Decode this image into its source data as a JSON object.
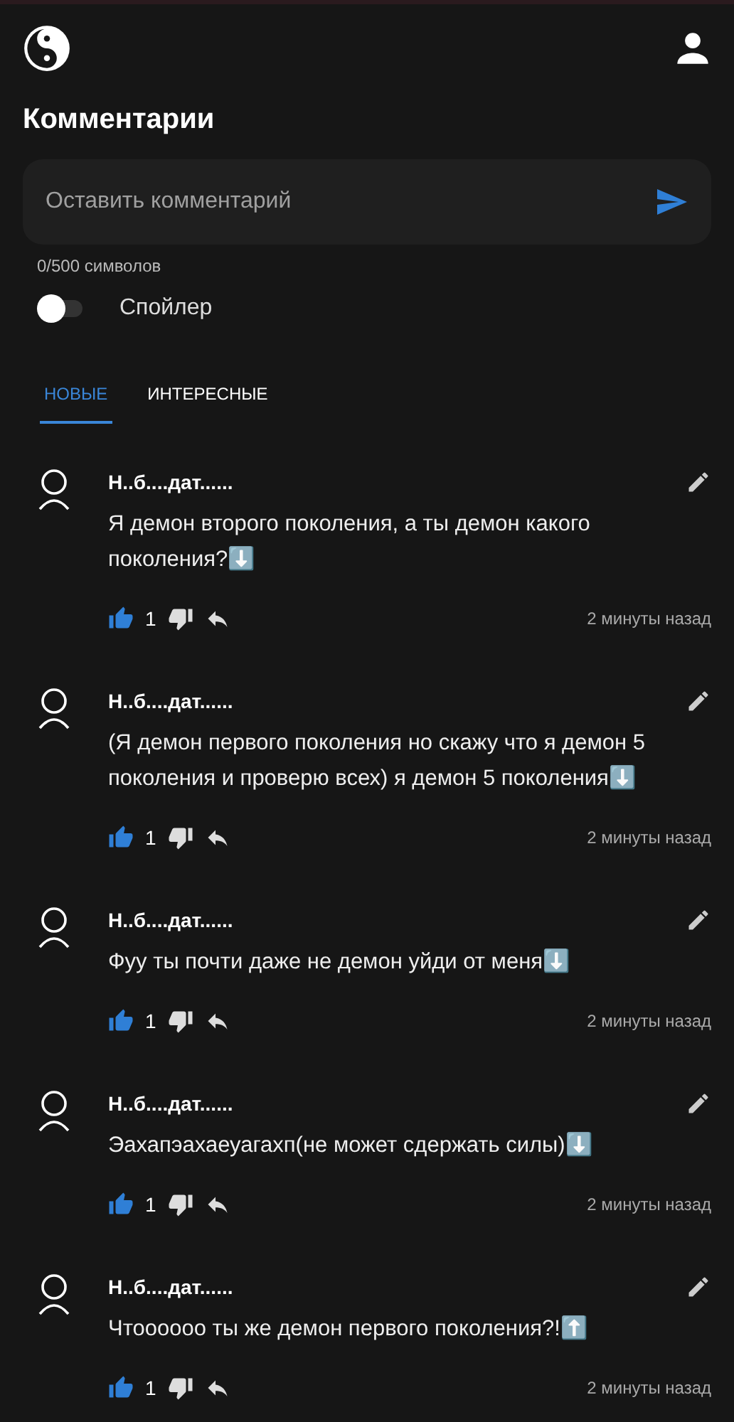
{
  "header": {
    "title": "Комментарии"
  },
  "composer": {
    "placeholder": "Оставить комментарий",
    "counter": "0/500 символов"
  },
  "spoiler": {
    "label": "Спойлер",
    "on": false
  },
  "tabs": [
    {
      "label": "НОВЫЕ",
      "selected": true
    },
    {
      "label": "ИНТЕРЕСНЫЕ",
      "selected": false
    }
  ],
  "comments": [
    {
      "author": "Н..б....дат......",
      "text": "Я демон второго поколения, а ты демон какого поколения?⬇️",
      "likes": "1",
      "liked": true,
      "time": "2 минуты назад"
    },
    {
      "author": "Н..б....дат......",
      "text": "(Я демон первого поколения но скажу что я демон 5 поколения и проверю всех) я демон 5 поколения⬇️",
      "likes": "1",
      "liked": true,
      "time": "2 минуты назад"
    },
    {
      "author": "Н..б....дат......",
      "text": "Фуу ты почти даже не демон уйди от меня⬇️",
      "likes": "1",
      "liked": true,
      "time": "2 минуты назад"
    },
    {
      "author": "Н..б....дат......",
      "text": "Эахапэахаеуагахп(не может сдержать силы)⬇️",
      "likes": "1",
      "liked": true,
      "time": "2 минуты назад"
    },
    {
      "author": "Н..б....дат......",
      "text": "Чтоооооо ты же демон первого поколения?!⬆️",
      "likes": "1",
      "liked": true,
      "time": "2 минуты назад"
    }
  ]
}
